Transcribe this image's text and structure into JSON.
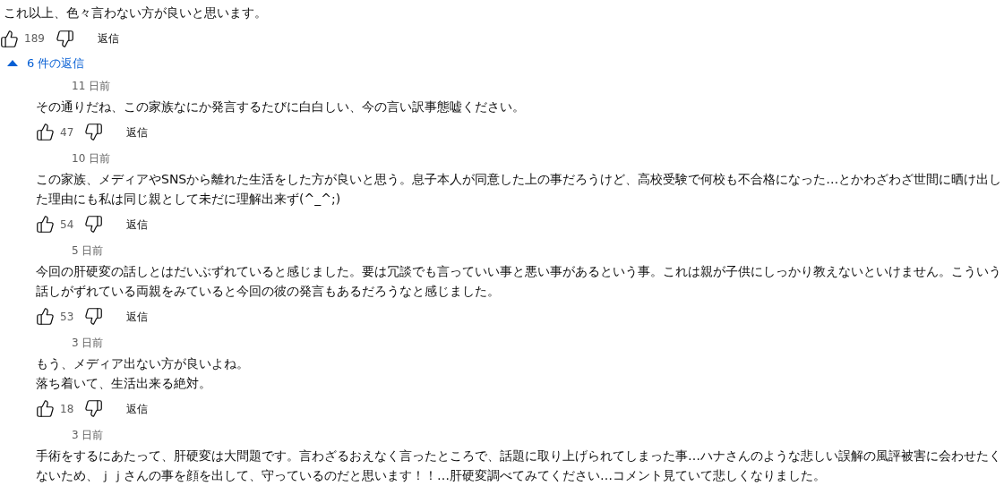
{
  "comment": {
    "lines": [
      "これ以上、色々言わない方が良いと思います。"
    ],
    "likes": "189",
    "reply_label": "返信"
  },
  "replies_toggle": {
    "label": "6 件の返信",
    "expanded": true
  },
  "replies": [
    {
      "time": "11 日前",
      "lines": [
        "その通りだね、この家族なにか発言するたびに白白しい、今の言い訳事態嘘ください。"
      ],
      "likes": "47",
      "reply_label": "返信"
    },
    {
      "time": "10 日前",
      "lines": [
        "この家族、メディアやSNSから離れた生活をした方が良いと思う。息子本人が同意した上の事だろうけど、高校受験で何校も不合格になった…とかわざわざ世間に晒け出し",
        "た理由にも私は同じ親として未だに理解出来ず(^_^;)"
      ],
      "likes": "54",
      "reply_label": "返信"
    },
    {
      "time": "5 日前",
      "lines": [
        "今回の肝硬変の話しとはだいぶずれていると感じました。要は冗談でも言っていい事と悪い事があるという事。これは親が子供にしっかり教えないといけません。こういう",
        "話しがずれている両親をみていると今回の彼の発言もあるだろうなと感じました。"
      ],
      "likes": "53",
      "reply_label": "返信"
    },
    {
      "time": "3 日前",
      "lines": [
        "もう、メディア出ない方が良いよね。",
        "落ち着いて、生活出来る絶対。"
      ],
      "likes": "18",
      "reply_label": "返信"
    },
    {
      "time": "3 日前",
      "lines": [
        "手術をするにあたって、肝硬変は大問題です。言わざるおえなく言ったところで、話題に取り上げられてしまった事…ハナさんのような悲しい誤解の風評被害に会わせたく",
        "ないため、ｊｊさんの事を顔を出して、守っているのだと思います！！…肝硬変調べてみてください…コメント見ていて悲しくなりました。"
      ]
    }
  ]
}
